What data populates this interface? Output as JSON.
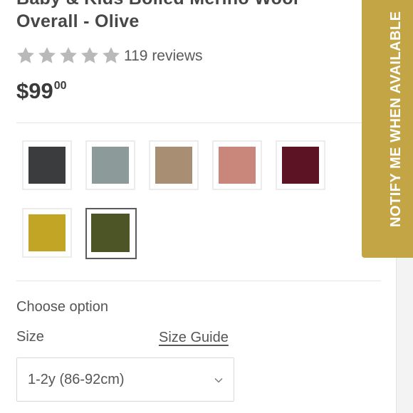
{
  "product": {
    "title": "Baby & Kids Boiled Merino Wool Overall - Olive",
    "rating": 5,
    "reviews": "119 reviews",
    "price_main": "$99",
    "price_cents": "00"
  },
  "swatches": [
    {
      "name": "charcoal",
      "color": "#3a3c3d",
      "selected": false
    },
    {
      "name": "grey-blue",
      "color": "#8c9a9a",
      "selected": false
    },
    {
      "name": "tan",
      "color": "#a88f74",
      "selected": false
    },
    {
      "name": "rose",
      "color": "#c9867a",
      "selected": false
    },
    {
      "name": "burgundy",
      "color": "#5c1424",
      "selected": false
    },
    {
      "name": "mustard",
      "color": "#c3a526",
      "selected": false
    },
    {
      "name": "olive",
      "color": "#4d5526",
      "selected": true
    }
  ],
  "options": {
    "heading": "Choose option",
    "size_label": "Size",
    "size_guide": "Size Guide",
    "size_value": "1-2y (86-92cm)"
  },
  "notify_button": "NOTIFY ME WHEN AVAILABLE",
  "colors": {
    "accent": "#c3a546",
    "star": "#b9b9b9"
  }
}
